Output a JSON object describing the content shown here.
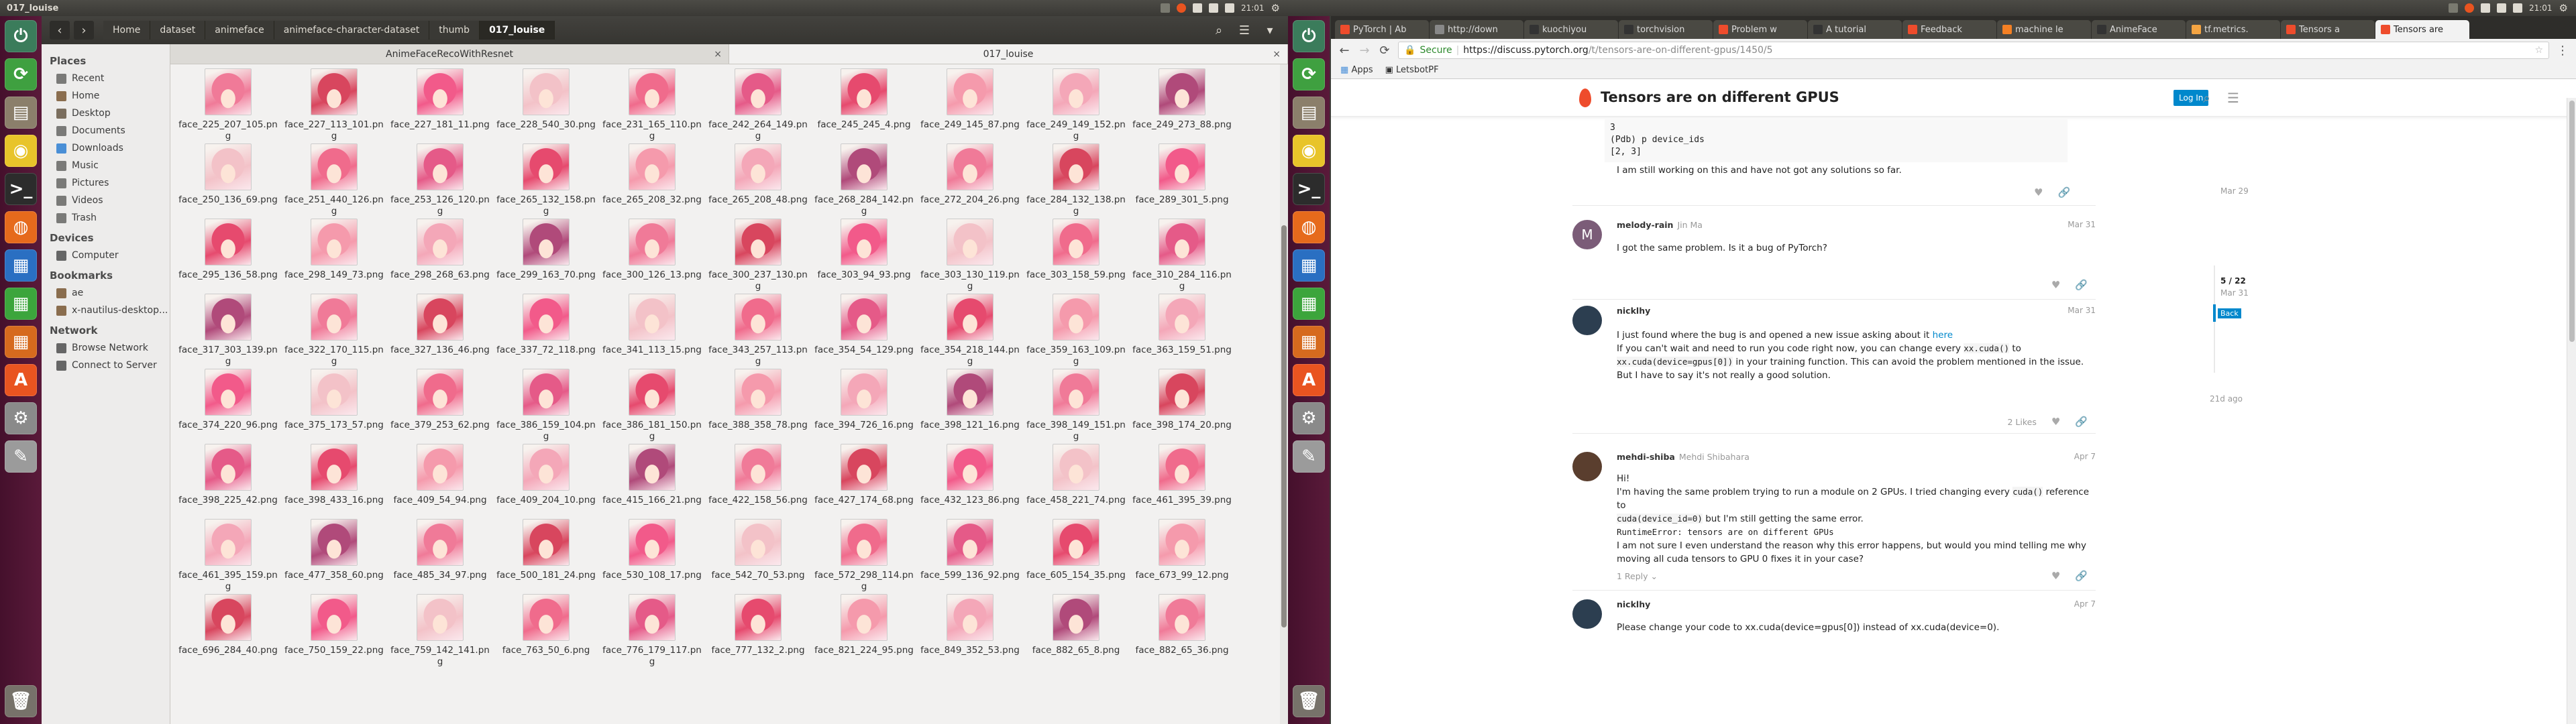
{
  "topbar_left": {
    "title": "017_louise",
    "time": "21:01"
  },
  "topbar_right": {
    "time": "21:01"
  },
  "launcher": {
    "items": [
      {
        "icon": "system-icon",
        "color": "#3b7c5b",
        "glyph": "⏻"
      },
      {
        "icon": "update-icon",
        "color": "#3fa040",
        "glyph": "⟳"
      },
      {
        "icon": "files-icon",
        "color": "#8b7f6b",
        "glyph": "▤"
      },
      {
        "icon": "chrome-icon",
        "color": "#e8c42a",
        "glyph": "◉"
      },
      {
        "icon": "terminal-icon",
        "color": "#2c2c2c",
        "glyph": ">_"
      },
      {
        "icon": "firefox-icon",
        "color": "#e66a1c",
        "glyph": "◍"
      },
      {
        "icon": "writer-icon",
        "color": "#2a6fc2",
        "glyph": "▦"
      },
      {
        "icon": "calc-icon",
        "color": "#3ca53c",
        "glyph": "▦"
      },
      {
        "icon": "impress-icon",
        "color": "#d66a1e",
        "glyph": "▦"
      },
      {
        "icon": "appstore-icon",
        "color": "#e95420",
        "glyph": "A"
      },
      {
        "icon": "settings-icon",
        "color": "#8a8a8a",
        "glyph": "⚙"
      },
      {
        "icon": "texteditor-icon",
        "color": "#9b9b9b",
        "glyph": "✎"
      }
    ],
    "trash_icon": "trash-icon"
  },
  "nautilus": {
    "breadcrumbs": [
      "Home",
      "dataset",
      "animeface",
      "animeface-character-dataset",
      "thumb",
      "017_louise"
    ],
    "tabs": [
      {
        "label": "AnimeFaceRecoWithResnet"
      },
      {
        "label": "017_louise"
      }
    ],
    "sidebar": {
      "places_title": "Places",
      "places": [
        "Recent",
        "Home",
        "Desktop",
        "Documents",
        "Downloads",
        "Music",
        "Pictures",
        "Videos",
        "Trash"
      ],
      "devices_title": "Devices",
      "devices": [
        "Computer"
      ],
      "bookmarks_title": "Bookmarks",
      "bookmarks": [
        "ae",
        "x-nautilus-desktop..."
      ],
      "network_title": "Network",
      "network": [
        "Browse Network",
        "Connect to Server"
      ]
    },
    "files": [
      "face_225_207_105.png",
      "face_227_113_101.png",
      "face_227_181_11.png",
      "face_228_540_30.png",
      "face_231_165_110.png",
      "face_242_264_149.png",
      "face_245_245_4.png",
      "face_249_145_87.png",
      "face_249_149_152.png",
      "face_249_273_88.png",
      "face_250_136_69.png",
      "face_251_440_126.png",
      "face_253_126_120.png",
      "face_265_132_158.png",
      "face_265_208_32.png",
      "face_265_208_48.png",
      "face_268_284_142.png",
      "face_272_204_26.png",
      "face_284_132_138.png",
      "face_289_301_5.png",
      "face_295_136_58.png",
      "face_298_149_73.png",
      "face_298_268_63.png",
      "face_299_163_70.png",
      "face_300_126_13.png",
      "face_300_237_130.png",
      "face_303_94_93.png",
      "face_303_130_119.png",
      "face_303_158_59.png",
      "face_310_284_116.png",
      "face_317_303_139.png",
      "face_322_170_115.png",
      "face_327_136_46.png",
      "face_337_72_118.png",
      "face_341_113_15.png",
      "face_343_257_113.png",
      "face_354_54_129.png",
      "face_354_218_144.png",
      "face_359_163_109.png",
      "face_363_159_51.png",
      "face_374_220_96.png",
      "face_375_173_57.png",
      "face_379_253_62.png",
      "face_386_159_104.png",
      "face_386_181_150.png",
      "face_388_358_78.png",
      "face_394_726_16.png",
      "face_398_121_16.png",
      "face_398_149_151.png",
      "face_398_174_20.png",
      "face_398_225_42.png",
      "face_398_433_16.png",
      "face_409_54_94.png",
      "face_409_204_10.png",
      "face_415_166_21.png",
      "face_422_158_56.png",
      "face_427_174_68.png",
      "face_432_123_86.png",
      "face_458_221_74.png",
      "face_461_395_39.png",
      "face_461_395_159.png",
      "face_477_358_60.png",
      "face_485_34_97.png",
      "face_500_181_24.png",
      "face_530_108_17.png",
      "face_542_70_53.png",
      "face_572_298_114.png",
      "face_599_136_92.png",
      "face_605_154_35.png",
      "face_673_99_12.png",
      "face_696_284_40.png",
      "face_750_159_22.png",
      "face_759_142_141.png",
      "face_763_50_6.png",
      "face_776_179_117.png",
      "face_777_132_2.png",
      "face_821_224_95.png",
      "face_849_352_53.png",
      "face_882_65_8.png",
      "face_882_65_36.png"
    ],
    "thumb_colors": [
      "#f07a98",
      "#f3c2c8",
      "#e64a6e",
      "#b04a7a",
      "#f25a8a",
      "#e55a88",
      "#f4a7b8",
      "#d8465e",
      "#f06b8c",
      "#f59aac"
    ]
  },
  "chrome": {
    "tabs": [
      {
        "label": "PyTorch | Ab",
        "color": "#ee4c2c"
      },
      {
        "label": "http://down",
        "color": "#888"
      },
      {
        "label": "kuochiyou",
        "color": "#333"
      },
      {
        "label": "torchvision",
        "color": "#333"
      },
      {
        "label": "Problem w",
        "color": "#ee4c2c"
      },
      {
        "label": "A tutorial",
        "color": "#333"
      },
      {
        "label": "Feedback",
        "color": "#ee4c2c"
      },
      {
        "label": "machine le",
        "color": "#f48024"
      },
      {
        "label": "AnimeFace",
        "color": "#333"
      },
      {
        "label": "tf.metrics.",
        "color": "#f4a442"
      },
      {
        "label": "Tensors a",
        "color": "#ee4c2c"
      },
      {
        "label": "Tensors are",
        "color": "#ee4c2c"
      }
    ],
    "url_secure": "Secure",
    "url_host": "https://discuss.pytorch.org",
    "url_path": "/t/tensors-are-on-different-gpus/1450/5",
    "bookmarks": [
      {
        "label": "Apps"
      },
      {
        "label": "LetsbotPF"
      }
    ],
    "forum": {
      "title": "Tensors are on different GPUS",
      "login": "Log In",
      "code_lines": [
        "3",
        "(Pdb) p device_ids",
        "[2, 3]"
      ],
      "first_text": "I am still working on this and have not got any solutions so far.",
      "timeline_top": "Mar 29",
      "timeline_pos": "5 / 22",
      "timeline_date": "Mar 31",
      "timeline_back": "Back",
      "timeline_bottom": "21d ago",
      "posts": [
        {
          "user": "melody-rain",
          "name": "Jin Ma",
          "date": "Mar 31",
          "text": "I got the same problem. Is it a bug of PyTorch?",
          "avatar": "#7b5c78"
        },
        {
          "user": "nicklhy",
          "name": "",
          "date": "Mar 31",
          "l1": "I just found where the bug is and opened a new issue asking about it",
          "link": "here",
          "l2a": "If you can't wait and need to run you code right now, you can change every",
          "c1": "xx.cuda()",
          "l2b": "to",
          "c2": "xx.cuda(device=gpus[0])",
          "l3": "in your training function. This can avoid the problem mentioned in the issue.",
          "l4": "But I have to say it's not really a good solution.",
          "likes": "2 Likes",
          "avatar": "#2c3e50"
        },
        {
          "user": "mehdi-shiba",
          "name": "Mehdi Shibahara",
          "date": "Apr 7",
          "l1": "Hi!",
          "l2a": "I'm having the same problem trying to run a module on 2 GPUs. I tried changing every",
          "c1": "cuda()",
          "l2b": "reference to",
          "c2": "cuda(device_id=0)",
          "l2c": "but I'm still getting the same error.",
          "c3": "RuntimeError: tensors are on different GPUs",
          "l4": "I am not sure I even understand the reason why this error happens, but would you mind telling me why moving all cuda tensors to GPU 0 fixes it in your case?",
          "reply": "1 Reply",
          "avatar": "#5a3e2e"
        },
        {
          "user": "nicklhy",
          "name": "",
          "date": "Apr 7",
          "text": "Please change your code to xx.cuda(device=gpus[0]) instead of xx.cuda(device=0).",
          "avatar": "#2c3e50"
        }
      ]
    }
  },
  "colors": {
    "launcher": "#4e1535",
    "panel": "#3c3b37",
    "pytorch": "#ee4c2c",
    "link": "#0088cc"
  }
}
